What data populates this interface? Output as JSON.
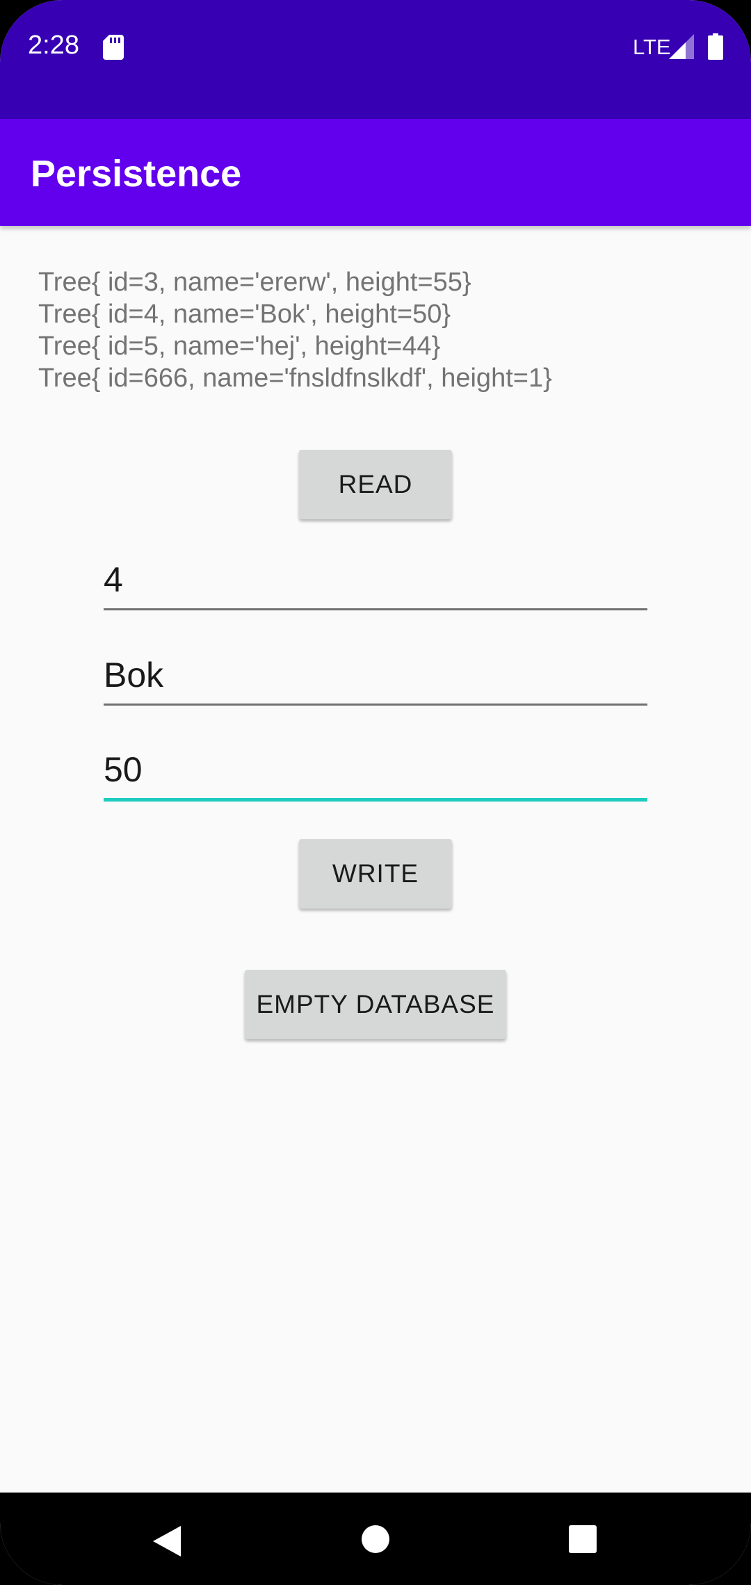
{
  "status_bar": {
    "time": "2:28",
    "network": "LTE",
    "icons": [
      "sd-card-icon",
      "signal-icon",
      "battery-icon"
    ]
  },
  "app_bar": {
    "title": "Persistence"
  },
  "records": [
    "Tree{ id=3, name='ererw', height=55}",
    "Tree{ id=4, name='Bok', height=50}",
    "Tree{ id=5, name='hej', height=44}",
    "Tree{ id=666, name='fnsldfnslkdf', height=1}"
  ],
  "buttons": {
    "read": "READ",
    "write": "WRITE",
    "empty": "EMPTY DATABASE"
  },
  "fields": {
    "id": "4",
    "name": "Bok",
    "height": "50"
  },
  "nav_bar": {
    "icons": [
      "back-icon",
      "home-icon",
      "recents-icon"
    ]
  },
  "colors": {
    "status_bar": "#3700b3",
    "app_bar": "#6200ee",
    "accent": "#1ecbbf",
    "button": "#d6d7d7"
  }
}
